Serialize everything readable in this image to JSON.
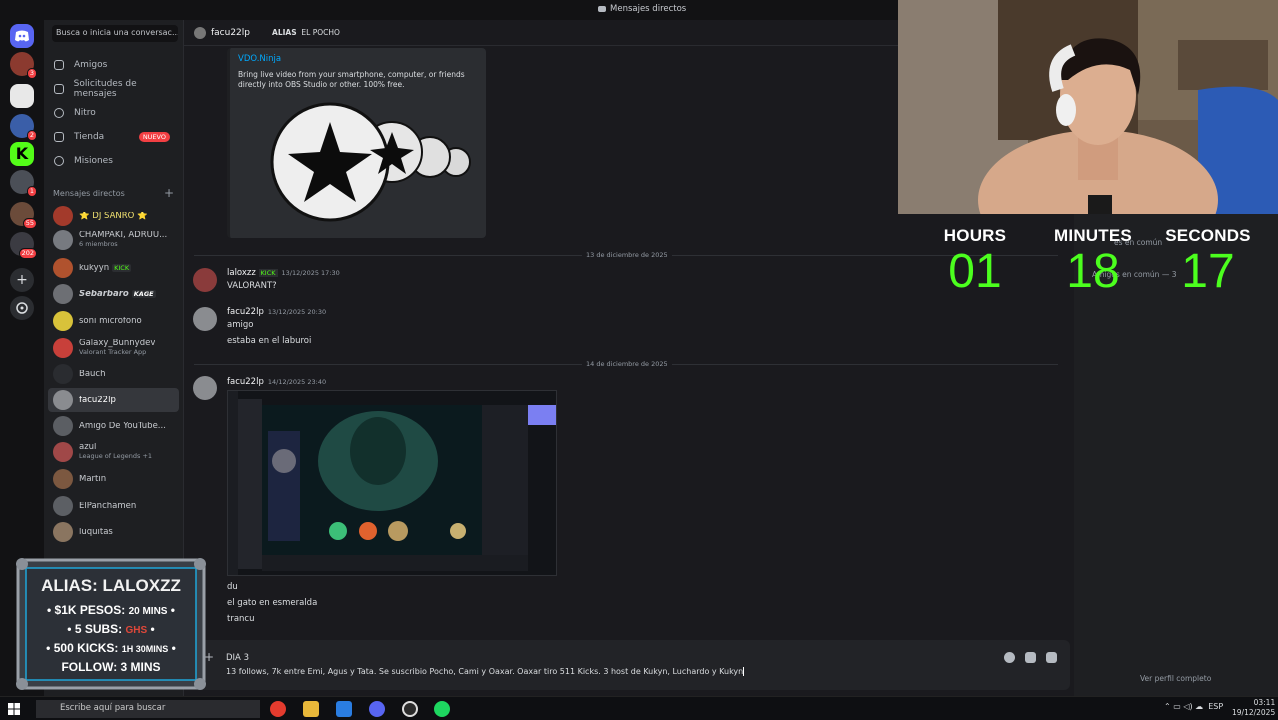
{
  "window": {
    "title": "Mensajes directos"
  },
  "sidebar": {
    "search_placeholder": "Busca o inicia una conversac...",
    "nav": [
      {
        "label": "Amigos"
      },
      {
        "label": "Solicitudes de mensajes"
      },
      {
        "label": "Nitro"
      },
      {
        "label": "Tienda",
        "badge": "NUEVO"
      },
      {
        "label": "Misiones"
      }
    ],
    "dm_header": "Mensajes directos",
    "dms": [
      {
        "name": "⭐ DJ SANRO ⭐",
        "sub": ""
      },
      {
        "name": "CHAMPAKI, ADRUU...",
        "sub": "6 miembros"
      },
      {
        "name": "kukyyn",
        "tag": "KICK",
        "sub": ""
      },
      {
        "name": "Sebarbaro",
        "tag": "KAGE",
        "sub": ""
      },
      {
        "name": "soni microfono",
        "sub": ""
      },
      {
        "name": "Galaxy_Bunnydev",
        "sub": "Valorant Tracker App"
      },
      {
        "name": "Bauch",
        "sub": ""
      },
      {
        "name": "facu22lp",
        "sub": ""
      },
      {
        "name": "Amigo De YouTube...",
        "sub": ""
      },
      {
        "name": "azul",
        "sub": "League of Legends +1"
      },
      {
        "name": "Martin",
        "sub": ""
      },
      {
        "name": "ElPanchamen",
        "sub": ""
      },
      {
        "name": "luquitas",
        "sub": ""
      }
    ],
    "server_badges": [
      "3",
      "2",
      "1",
      "55",
      "202"
    ]
  },
  "chat": {
    "header": {
      "name": "facu22lp",
      "alias_label": "ALIAS",
      "alias_value": "EL POCHO"
    },
    "embed": {
      "title": "VDO.Ninja",
      "description": "Bring live video from your smartphone, computer, or friends directly into OBS Studio or other. 100% free."
    },
    "dividers": [
      "13 de diciembre de 2025",
      "14 de diciembre de 2025"
    ],
    "messages": [
      {
        "author": "laloxzz",
        "tag": "KICK",
        "time": "13/12/2025 17:30",
        "lines": [
          "VALORANT?"
        ]
      },
      {
        "author": "facu22lp",
        "time": "13/12/2025 20:30",
        "lines": [
          "amigo",
          "estaba en el laburoi"
        ]
      },
      {
        "author": "facu22lp",
        "time": "14/12/2025 23:40",
        "lines": [
          "du",
          "el gato en esmeralda",
          "trancu"
        ]
      }
    ],
    "composer": {
      "line1": "DIA 3",
      "line2": "13 follows, 7k entre Emi, Agus y Tata. Se suscribio Pocho, Cami y Oaxar. Oaxar tiro 511 Kicks. 3 host de Kukyn, Luchardo y Kukyn"
    }
  },
  "profile": {
    "line1": "es en común",
    "line2": "Amigos en común — 3",
    "view_full": "Ver perfil completo"
  },
  "timer": {
    "labels": [
      "HOURS",
      "MINUTES",
      "SECONDS"
    ],
    "values": [
      "01",
      "18",
      "17"
    ],
    "color": "#4cff1e"
  },
  "overlay": {
    "alias": "ALIAS: LALOXZZ",
    "items": [
      {
        "text": "$1K PESOS:",
        "value": "20 MINS"
      },
      {
        "text": "5 SUBS:",
        "value": "GHS"
      },
      {
        "text": "500 KICKS:",
        "value": "1H 30MINS"
      },
      {
        "text": "FOLLOW:",
        "value": "3 MINS"
      }
    ]
  },
  "taskbar": {
    "search_placeholder": "Escribe aquí para buscar",
    "lang": "ESP",
    "time": "03:11",
    "date": "19/12/2025"
  },
  "colors": {
    "accent": "#5865f2",
    "kick_green": "#53fc18",
    "badge_red": "#f23f43",
    "link": "#00a8fc"
  }
}
